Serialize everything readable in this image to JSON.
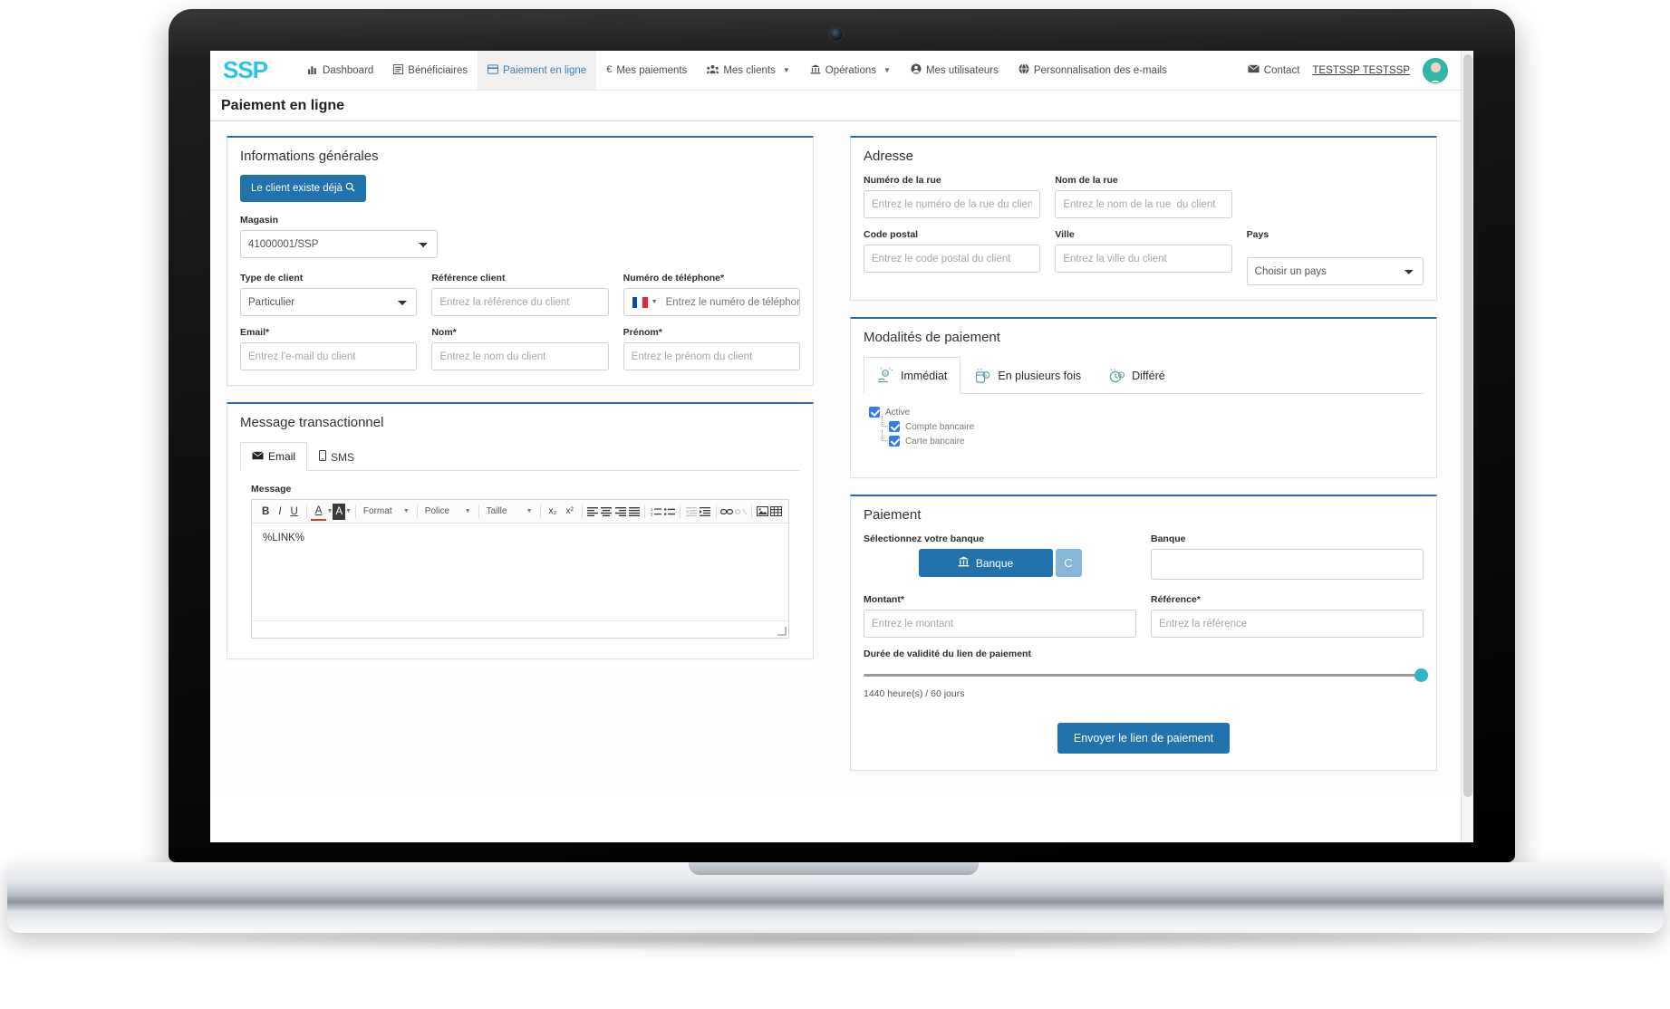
{
  "navbar": {
    "brand": "SSP",
    "items": [
      {
        "label": "Dashboard",
        "icon": "bar-chart-icon",
        "glyph": "▐‖",
        "active": false,
        "caret": false
      },
      {
        "label": "Bénéficiaires",
        "icon": "list-icon",
        "glyph": "☰",
        "active": false,
        "caret": false
      },
      {
        "label": "Paiement en ligne",
        "icon": "card-icon",
        "glyph": "▤",
        "active": true,
        "caret": false
      },
      {
        "label": "Mes paiements",
        "icon": "euro-icon",
        "glyph": "€",
        "active": false,
        "caret": false
      },
      {
        "label": "Mes clients",
        "icon": "users-icon",
        "glyph": "♣",
        "active": false,
        "caret": true
      },
      {
        "label": "Opérations",
        "icon": "bank-icon",
        "glyph": "ἽB",
        "active": false,
        "caret": true
      },
      {
        "label": "Mes utilisateurs",
        "icon": "user-circle-icon",
        "glyph": "●",
        "active": false,
        "caret": false
      },
      {
        "label": "Personnalisation des e-mails",
        "icon": "globe-icon",
        "glyph": "●",
        "active": false,
        "caret": false
      }
    ],
    "contact_label": "Contact",
    "contact_icon": "envelope-icon",
    "user_name": "TESTSSP TESTSSP",
    "avatar_icon": "user-avatar"
  },
  "page": {
    "title": "Paiement en ligne"
  },
  "informations_generales": {
    "title": "Informations générales",
    "existing_client_button": "Le client existe déjà",
    "existing_client_icon": "search-icon",
    "magasin_label": "Magasin",
    "magasin_value": "41000001/SSP",
    "type_client_label": "Type de client",
    "type_client_value": "Particulier",
    "reference_client_label": "Référence client",
    "reference_client_placeholder": "Entrez la référence du client",
    "telephone_label": "Numéro de téléphone*",
    "telephone_placeholder": "Entrez le numéro de téléphone du client",
    "telephone_flag": "fr-flag-icon",
    "email_label": "Email*",
    "email_placeholder": "Entrez l'e-mail du client",
    "nom_label": "Nom*",
    "nom_placeholder": "Entrez le nom du client",
    "prenom_label": "Prénom*",
    "prenom_placeholder": "Entrez le prénom du client"
  },
  "message_transactionnel": {
    "title": "Message transactionnel",
    "tabs": [
      {
        "label": "Email",
        "icon": "envelope-icon",
        "glyph": "✉",
        "active": true
      },
      {
        "label": "SMS",
        "icon": "mobile-icon",
        "glyph": "☐",
        "active": false
      }
    ],
    "message_label": "Message",
    "toolbar": {
      "bold": "B",
      "italic": "I",
      "underline": "U",
      "text_color": "A",
      "bg_color": "A",
      "format": "Format",
      "police": "Police",
      "taille": "Taille",
      "subscript": "x₂",
      "superscript": "x²",
      "icons": [
        "align-left-icon",
        "align-center-icon",
        "align-right-icon",
        "align-justify-icon",
        "ordered-list-icon",
        "unordered-list-icon",
        "outdent-icon",
        "indent-icon",
        "link-icon",
        "unlink-icon",
        "image-icon",
        "table-icon"
      ]
    },
    "body_text": "%LINK%"
  },
  "adresse": {
    "title": "Adresse",
    "numero_rue_label": "Numéro de la rue",
    "numero_rue_placeholder": "Entrez le numéro de la rue du client",
    "nom_rue_label": "Nom de la rue",
    "nom_rue_placeholder": "Entrez le nom de la rue  du client",
    "code_postal_label": "Code postal",
    "code_postal_placeholder": "Entrez le code postal du client",
    "ville_label": "Ville",
    "ville_placeholder": "Entrez la ville du client",
    "pays_label": "Pays",
    "pays_value": "Choisir un pays"
  },
  "modalites_paiement": {
    "title": "Modalités de paiement",
    "tabs": [
      {
        "label": "Immédiat",
        "icon": "hand-coin-icon",
        "glyph": "◎",
        "active": true
      },
      {
        "label": "En plusieurs fois",
        "icon": "calendar-clock-icon",
        "glyph": "◔",
        "active": false
      },
      {
        "label": "Différé",
        "icon": "clock-icon",
        "glyph": "◑",
        "active": false
      }
    ],
    "checkboxes": [
      {
        "label": "Active",
        "checked": true,
        "level": 0
      },
      {
        "label": "Compte bancaire",
        "checked": true,
        "level": 1
      },
      {
        "label": "Carte bancaire",
        "checked": true,
        "level": 1
      }
    ]
  },
  "paiement": {
    "title": "Paiement",
    "select_bank_label": "Sélectionnez votre banque",
    "bank_button_label": "Banque",
    "bank_button_icon": "bank-icon",
    "refresh_button_label": "C",
    "refresh_button_icon": "refresh-icon",
    "banque_label": "Banque",
    "banque_value": "",
    "montant_label": "Montant*",
    "montant_placeholder": "Entrez le montant",
    "reference_label": "Référence*",
    "reference_placeholder": "Entrez la référence",
    "duree_label": "Durée de validité du lien de paiement",
    "duree_value_text": "1440 heure(s) / 60 jours",
    "slider_percent": 100,
    "submit_label": "Envoyer le lien de paiement"
  },
  "colors": {
    "brand_cyan": "#29c3ef",
    "primary_blue": "#2272ad",
    "panel_top_border": "#2d6ca2",
    "checkbox_blue": "#2f7df0",
    "slider_thumb": "#2fb5c6"
  }
}
